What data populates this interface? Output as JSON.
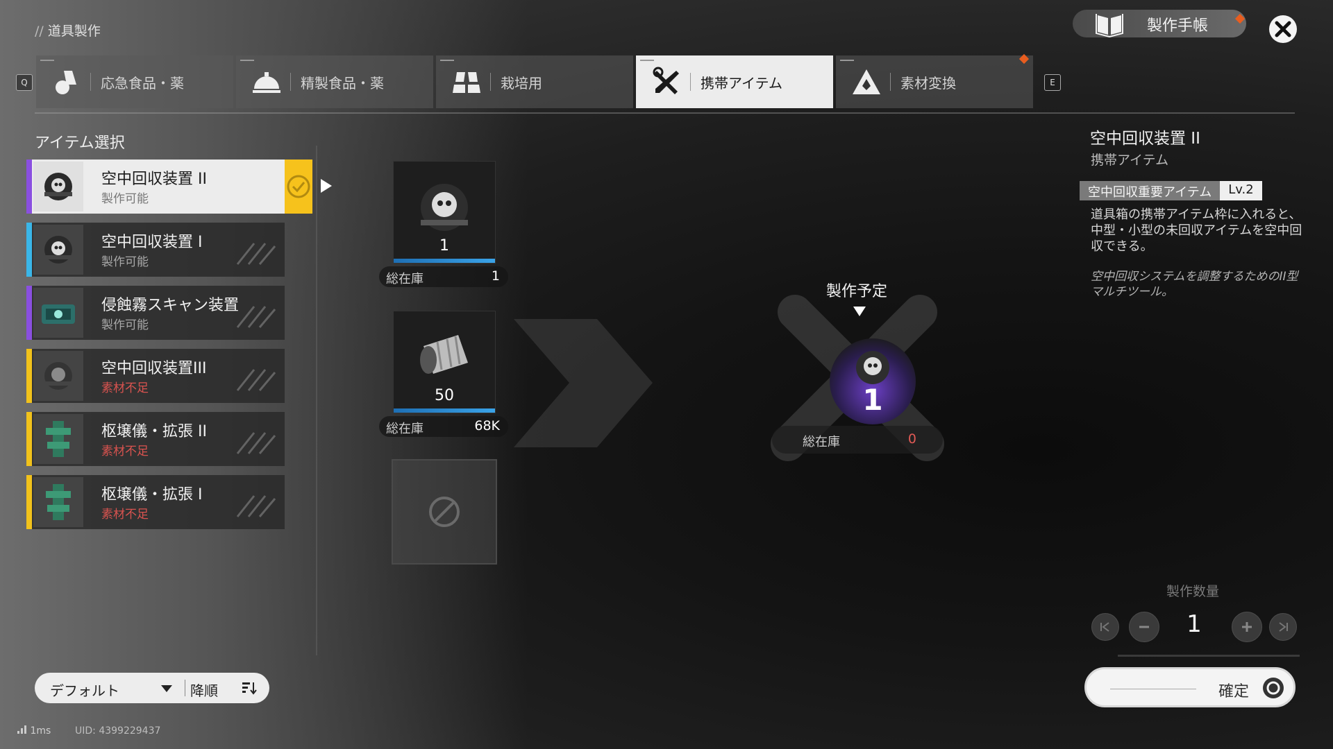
{
  "header": {
    "breadcrumb_slash": "//",
    "breadcrumb": "道具製作",
    "notebook_label": "製作手帳"
  },
  "tabs": [
    {
      "label": "応急食品・薬",
      "icon": "first-aid-icon"
    },
    {
      "label": "精製食品・薬",
      "icon": "dish-cover-icon"
    },
    {
      "label": "栽培用",
      "icon": "planter-icon"
    },
    {
      "label": "携帯アイテム",
      "icon": "tools-icon",
      "active": true
    },
    {
      "label": "素材変換",
      "icon": "conversion-icon"
    }
  ],
  "tab_key_left": "Q",
  "tab_key_right": "E",
  "list": {
    "title": "アイテム選択",
    "items": [
      {
        "name": "空中回収装置 II",
        "status": "製作可能",
        "status_ok": true,
        "rarity_color": "#8a4fe0"
      },
      {
        "name": "空中回収装置 I",
        "status": "製作可能",
        "status_ok": true,
        "rarity_color": "#3ab6e8"
      },
      {
        "name": "侵蝕霧スキャン装置",
        "status": "製作可能",
        "status_ok": true,
        "rarity_color": "#8a4fe0"
      },
      {
        "name": "空中回収装置III",
        "status": "素材不足",
        "status_ok": false,
        "rarity_color": "#f2c21b"
      },
      {
        "name": "枢壌儀・拡張 II",
        "status": "素材不足",
        "status_ok": false,
        "rarity_color": "#f2c21b"
      },
      {
        "name": "枢壌儀・拡張 I",
        "status": "素材不足",
        "status_ok": false,
        "rarity_color": "#f2c21b"
      }
    ]
  },
  "materials": [
    {
      "qty": "1",
      "stock_label": "総在庫",
      "stock": "1"
    },
    {
      "qty": "50",
      "stock_label": "総在庫",
      "stock": "68K"
    }
  ],
  "result": {
    "plan_label": "製作予定",
    "qty": "1",
    "stock_label": "総在庫",
    "stock": "0"
  },
  "detail": {
    "name": "空中回収装置 II",
    "category": "携帯アイテム",
    "tag": "空中回収重要アイテム",
    "level": "Lv.2",
    "description": "道具箱の携帯アイテム枠に入れると、中型・小型の未回収アイテムを空中回収できる。",
    "flavor": "空中回収システムを調整するためのII型マルチツール。"
  },
  "quantity": {
    "label": "製作数量",
    "value": "1",
    "confirm": "確定"
  },
  "sort": {
    "selected": "デフォルト",
    "order": "降順"
  },
  "footer": {
    "ping": "1ms",
    "uid": "UID: 4399229437"
  },
  "colors": {
    "accent_yellow": "#f6c21c",
    "alert_orange": "#e85d1f",
    "insufficient_red": "#d9534f",
    "progress_blue": "#3aa3e8"
  }
}
